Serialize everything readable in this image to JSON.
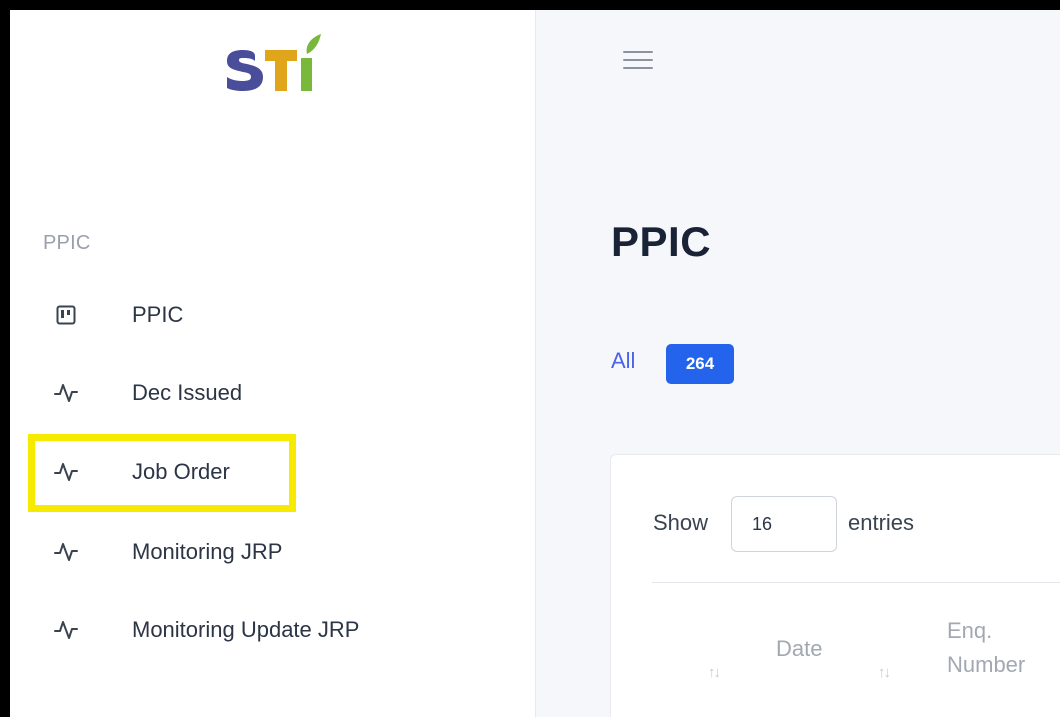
{
  "sidebar": {
    "logo_text": "STI",
    "section_header": "PPIC",
    "items": [
      {
        "label": "PPIC",
        "icon": "kanban-board-icon"
      },
      {
        "label": "Dec Issued",
        "icon": "activity-pulse-icon"
      },
      {
        "label": "Job Order",
        "icon": "activity-pulse-icon"
      },
      {
        "label": "Monitoring JRP",
        "icon": "activity-pulse-icon"
      },
      {
        "label": "Monitoring Update JRP",
        "icon": "activity-pulse-icon"
      }
    ],
    "highlighted_item": "Job Order",
    "highlight_color": "#f5ea00"
  },
  "topbar": {
    "menu_icon": "hamburger-menu-icon"
  },
  "main": {
    "title": "PPIC",
    "filter": {
      "label": "All",
      "count": "264",
      "badge_color": "#2463eb"
    },
    "table": {
      "show_label": "Show",
      "entries_value": "16",
      "entries_label": "entries",
      "sort_icon": "↑↓",
      "columns": [
        {
          "label": "Date"
        },
        {
          "label_line1": "Enq.",
          "label_line2": "Number"
        }
      ]
    }
  },
  "colors": {
    "accent": "#4c63e8",
    "sidebar_bg": "#ffffff",
    "main_bg": "#f5f7fb"
  }
}
